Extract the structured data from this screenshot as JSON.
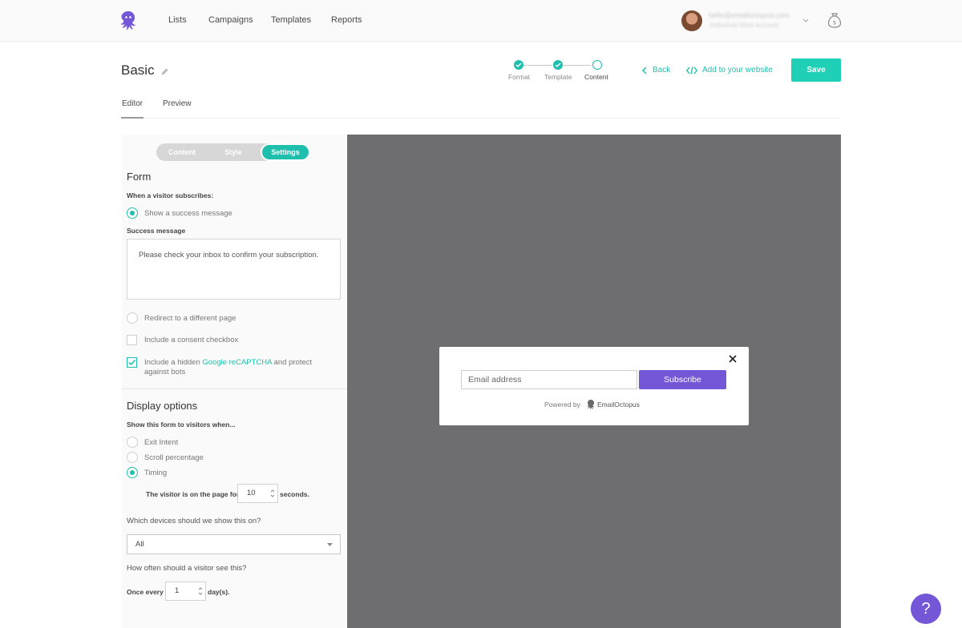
{
  "nav": {
    "links": [
      "Lists",
      "Campaigns",
      "Templates",
      "Reports"
    ],
    "account_email": "hello@emailoctopus.com",
    "account_name": "Individual Work Account"
  },
  "header": {
    "title": "Basic",
    "steps": [
      {
        "label": "Format",
        "state": "done"
      },
      {
        "label": "Template",
        "state": "done"
      },
      {
        "label": "Content",
        "state": "current"
      }
    ],
    "back_label": "Back",
    "embed_label": "Add to your website",
    "save_label": "Save"
  },
  "tabs": {
    "editor": "Editor",
    "preview": "Preview",
    "active": "Editor"
  },
  "panel": {
    "segments": [
      "Content",
      "Style",
      "Settings"
    ],
    "active_segment": "Settings",
    "form": {
      "title": "Form",
      "subscribe_label": "When a visitor subscribes:",
      "success_option": "Show a success message",
      "success_message_label": "Success message",
      "success_message": "Please check your inbox to confirm your subscription.",
      "redirect_option": "Redirect to a different page",
      "consent_option": "Include a consent checkbox",
      "recaptcha_prefix": "Include a hidden",
      "recaptcha_link": "Google reCAPTCHA",
      "recaptcha_suffix": "and protect",
      "recaptcha_line2": "against bots"
    },
    "display": {
      "title": "Display options",
      "show_when_label": "Show this form to visitors when...",
      "options": [
        "Exit Intent",
        "Scroll percentage",
        "Timing"
      ],
      "selected": "Timing",
      "timing_prefix": "The visitor is on the page for",
      "timing_value": "10",
      "timing_suffix": "seconds.",
      "devices_question": "Which devices should we show this on?",
      "devices_value": "All",
      "frequency_question": "How often should a visitor see this?",
      "frequency_prefix": "Once every",
      "frequency_value": "1",
      "frequency_suffix": "day(s)."
    }
  },
  "preview": {
    "email_placeholder": "Email address",
    "subscribe_label": "Subscribe",
    "powered_by": "Powered by",
    "brand": "EmailOctopus"
  },
  "help": {
    "label": "?"
  },
  "colors": {
    "accent": "#1fbfae",
    "save": "#1fcfb6",
    "purple": "#7357d6",
    "preview_bg": "#6e6e70"
  }
}
